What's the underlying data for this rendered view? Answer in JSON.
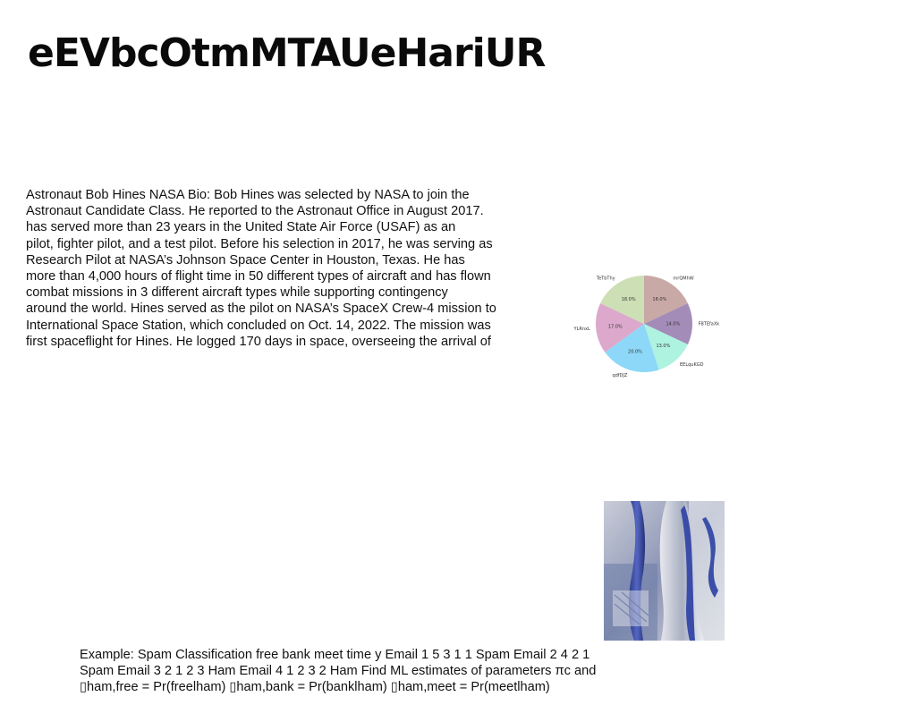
{
  "title": "eEVbcOtmMTAUeHariUR",
  "bio": {
    "lines": [
      "Astronaut Bob Hines NASA Bio: Bob Hines was selected by NASA to join the",
      "Astronaut Candidate Class. He reported to the Astronaut Office in August 2017.",
      "has served more than 23 years in the United State Air Force (USAF) as an",
      "pilot, fighter pilot, and a test pilot. Before his selection in 2017, he was serving as",
      "Research Pilot at NASA’s Johnson Space Center in Houston, Texas. He has",
      "more than 4,000 hours of flight time in 50 different types of aircraft and has flown",
      "combat missions in 3 different aircraft types while supporting contingency",
      "around the world. Hines served as the pilot on NASA’s SpaceX Crew-4 mission to",
      "International Space Station, which concluded on Oct. 14, 2022. The mission was",
      "first spaceflight for Hines. He logged 170 days in space, overseeing the arrival of"
    ]
  },
  "chart_data": {
    "type": "pie",
    "categories": [
      "mrQMhW",
      "FBTEfaXk",
      "EELquKGD",
      "qdfDJZ",
      "YLRnxL",
      "TeTbThy"
    ],
    "values": [
      18.0,
      14.0,
      13.0,
      20.0,
      17.0,
      18.0
    ],
    "labels_pct": [
      "18.0%",
      "14.0%",
      "13.0%",
      "20.0%",
      "17.0%",
      "18.0%"
    ],
    "colors": [
      "#c9a9a6",
      "#a38cb8",
      "#aef2e0",
      "#8dd8f8",
      "#dca8cc",
      "#cddfb4"
    ],
    "start_angle_deg": 90,
    "direction": "clockwise"
  },
  "photo": {
    "description_icon": "photo-image"
  },
  "example": {
    "lines": [
      "Example: Spam Classification free bank meet time y Email 1 5 3 1 1 Spam Email 2 4 2 1",
      "Spam Email 3 2 1 2 3 Ham Email 4 1 2 3 2 Ham Find ML estimates of parameters πc and",
      "▯ham,free = Pr(freelham) ▯ham,bank = Pr(banklham) ▯ham,meet = Pr(meetlham)"
    ]
  }
}
